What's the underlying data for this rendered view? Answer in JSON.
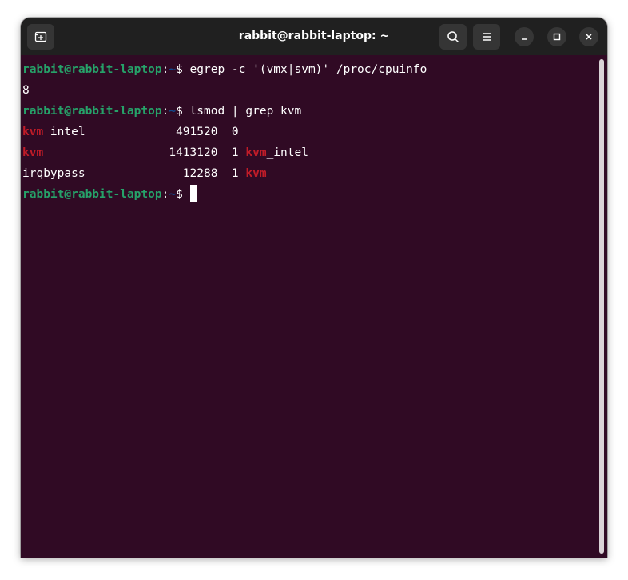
{
  "window": {
    "title": "rabbit@rabbit-laptop: ~",
    "buttons": {
      "new_tab": "new-tab-icon",
      "search": "search-icon",
      "menu": "hamburger-menu-icon",
      "minimize": "minimize-icon",
      "maximize": "maximize-icon",
      "close": "close-icon"
    }
  },
  "colors": {
    "terminal_bg": "#300a24",
    "titlebar_bg": "#202020",
    "prompt_user": "#26a269",
    "prompt_path": "#12488b",
    "match_highlight": "#c01c28",
    "text": "#ffffff"
  },
  "terminal": {
    "prompt_user": "rabbit@rabbit-laptop",
    "prompt_sep": ":",
    "prompt_path": "~",
    "prompt_symbol": "$",
    "cmd1": " egrep -c '(vmx|svm)' /proc/cpuinfo",
    "out1": "8",
    "cmd2": " lsmod | grep kvm",
    "rows": [
      {
        "hl": "kvm",
        "rest": "_intel             491520  0",
        "tail_hl": "",
        "tail_rest": ""
      },
      {
        "hl": "kvm",
        "rest": "                  1413120  1 ",
        "tail_hl": "kvm",
        "tail_rest": "_intel"
      },
      {
        "hl": "",
        "rest": "irqbypass              12288  1 ",
        "tail_hl": "kvm",
        "tail_rest": ""
      }
    ]
  }
}
